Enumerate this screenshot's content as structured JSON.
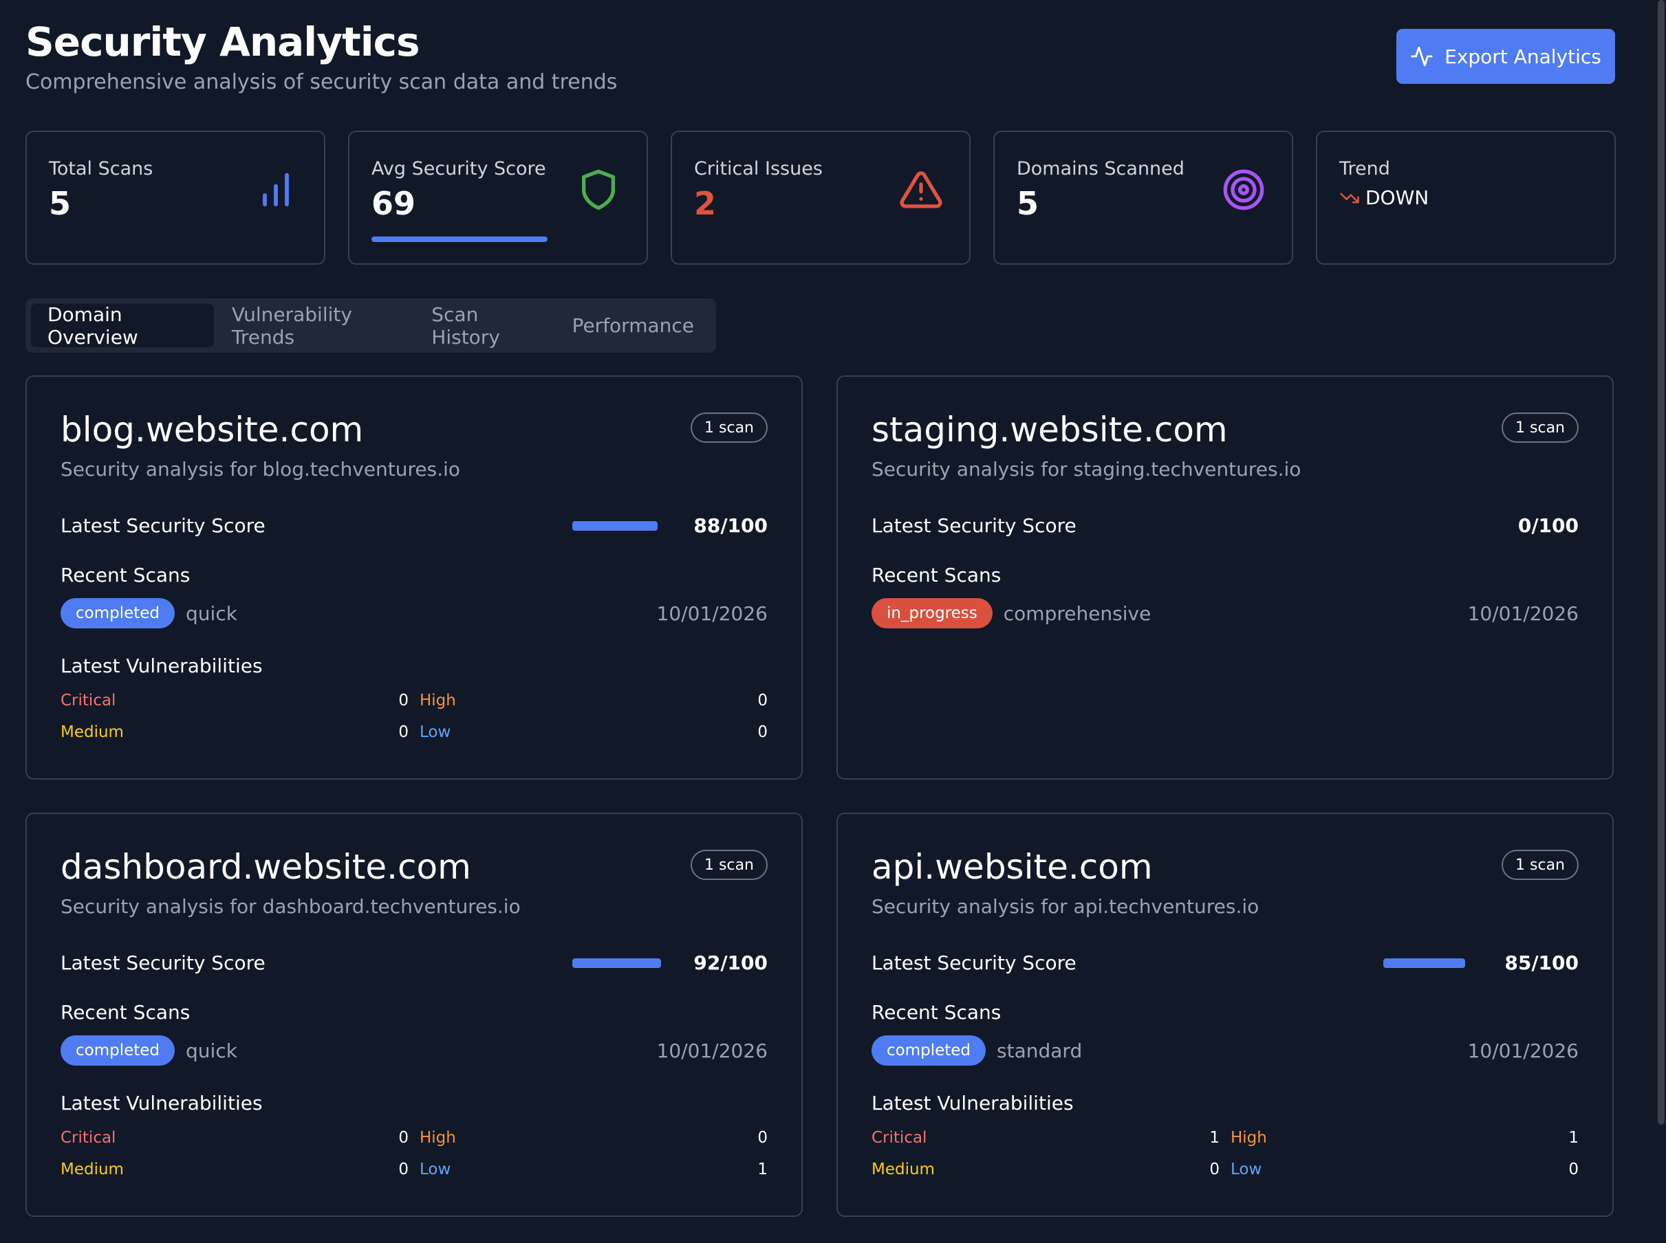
{
  "header": {
    "title": "Security Analytics",
    "subtitle": "Comprehensive analysis of security scan data and trends",
    "export_label": "Export Analytics"
  },
  "stats": [
    {
      "label": "Total Scans",
      "value": "5",
      "icon": "bar-chart-icon"
    },
    {
      "label": "Avg Security Score",
      "value": "69",
      "icon": "shield-icon",
      "progress": 0.69
    },
    {
      "label": "Critical Issues",
      "value": "2",
      "icon": "alert-triangle-icon"
    },
    {
      "label": "Domains Scanned",
      "value": "5",
      "icon": "target-icon"
    },
    {
      "label": "Trend",
      "value": "DOWN",
      "icon": "trending-down-icon"
    }
  ],
  "tabs": [
    {
      "label": "Domain Overview",
      "active": true
    },
    {
      "label": "Vulnerability Trends",
      "active": false
    },
    {
      "label": "Scan History",
      "active": false
    },
    {
      "label": "Performance",
      "active": false
    }
  ],
  "domains": [
    {
      "name": "blog.website.com",
      "description": "Security analysis for blog.techventures.io",
      "scan_count": "1 scan",
      "score_label": "Latest Security Score",
      "score_value": "88/100",
      "score": 0.88,
      "recent_label": "Recent Scans",
      "scan_status": "completed",
      "scan_type": "quick",
      "scan_date": "10/01/2026",
      "vuln_label": "Latest Vulnerabilities",
      "vulns": {
        "critical": "0",
        "high": "0",
        "medium": "0",
        "low": "0"
      }
    },
    {
      "name": "staging.website.com",
      "description": "Security analysis for staging.techventures.io",
      "scan_count": "1 scan",
      "score_label": "Latest Security Score",
      "score_value": "0/100",
      "score": 0,
      "recent_label": "Recent Scans",
      "scan_status": "in_progress",
      "scan_type": "comprehensive",
      "scan_date": "10/01/2026"
    },
    {
      "name": "dashboard.website.com",
      "description": "Security analysis for dashboard.techventures.io",
      "scan_count": "1 scan",
      "score_label": "Latest Security Score",
      "score_value": "92/100",
      "score": 0.92,
      "recent_label": "Recent Scans",
      "scan_status": "completed",
      "scan_type": "quick",
      "scan_date": "10/01/2026",
      "vuln_label": "Latest Vulnerabilities",
      "vulns": {
        "critical": "0",
        "high": "0",
        "medium": "0",
        "low": "1"
      }
    },
    {
      "name": "api.website.com",
      "description": "Security analysis for api.techventures.io",
      "scan_count": "1 scan",
      "score_label": "Latest Security Score",
      "score_value": "85/100",
      "score": 0.85,
      "recent_label": "Recent Scans",
      "scan_status": "completed",
      "scan_type": "standard",
      "scan_date": "10/01/2026",
      "vuln_label": "Latest Vulnerabilities",
      "vulns": {
        "critical": "1",
        "high": "1",
        "medium": "0",
        "low": "0"
      }
    }
  ],
  "vuln_labels": {
    "critical": "Critical",
    "high": "High",
    "medium": "Medium",
    "low": "Low"
  },
  "colors": {
    "background": "#111827",
    "accent": "#4f7cf2",
    "danger": "#e0533e",
    "success": "#4caf50",
    "purple": "#a855f7"
  }
}
